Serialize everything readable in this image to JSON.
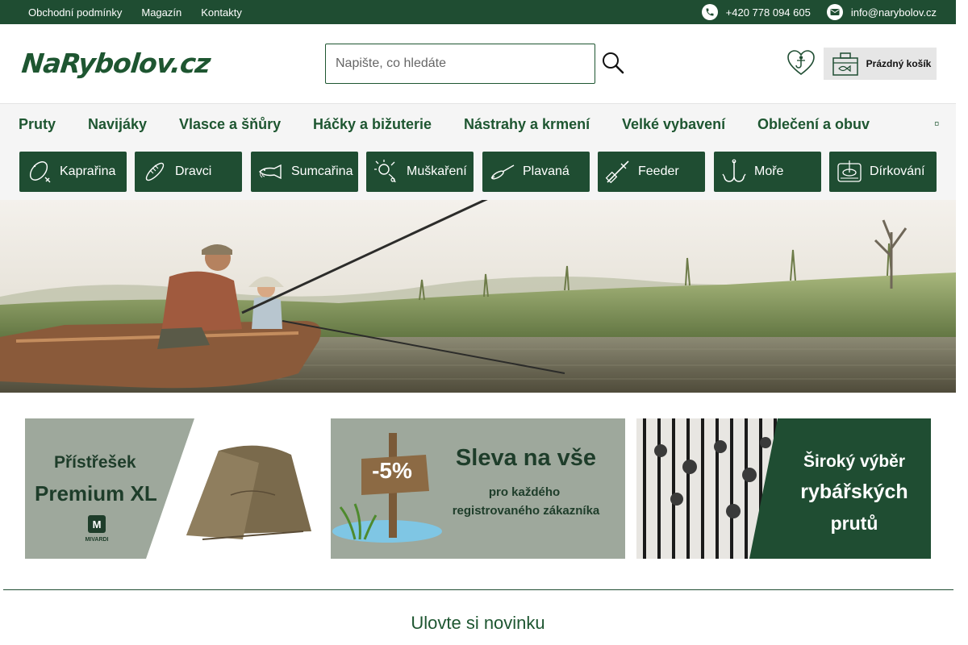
{
  "topbar": {
    "links": [
      "Obchodní podmínky",
      "Magazín",
      "Kontakty"
    ],
    "phone": "+420 778 094 605",
    "email": "info@narybolov.cz"
  },
  "header": {
    "logo_text": "NaRybolov.cz",
    "search": {
      "placeholder": "Napište, co hledáte",
      "value": ""
    },
    "cart_label": "Prázdný košík"
  },
  "mainnav": {
    "items": [
      "Pruty",
      "Navijáky",
      "Vlasce a šňůry",
      "Háčky a bižuterie",
      "Nástrahy a krmení",
      "Velké vybavení",
      "Oblečení a obuv"
    ],
    "more_glyph": ""
  },
  "categories": [
    {
      "label": "Kaprařina",
      "icon": "carp-icon"
    },
    {
      "label": "Dravci",
      "icon": "predator-fish-icon"
    },
    {
      "label": "Sumcařina",
      "icon": "catfish-icon"
    },
    {
      "label": "Muškaření",
      "icon": "fly-fishing-icon"
    },
    {
      "label": "Plavaná",
      "icon": "float-icon"
    },
    {
      "label": "Feeder",
      "icon": "feeder-icon"
    },
    {
      "label": "Moře",
      "icon": "sea-hook-icon"
    },
    {
      "label": "Dírkování",
      "icon": "ice-fishing-icon"
    }
  ],
  "banners": [
    {
      "line1": "Přístřešek",
      "line2": "Premium XL",
      "brand": "MIVARDI"
    },
    {
      "badge": "-5%",
      "headline": "Sleva na vše",
      "sub1": "pro každého",
      "sub2": "registrovaného zákazníka"
    },
    {
      "line1": "Široký výběr",
      "line2": "rybářských",
      "line3": "prutů"
    }
  ],
  "section_title": "Ulovte si novinku",
  "colors": {
    "brand_green": "#1f4d32",
    "text_green": "#1e5631",
    "nav_bg": "#f5f5f5",
    "banner_bg": "#9aa89c"
  }
}
